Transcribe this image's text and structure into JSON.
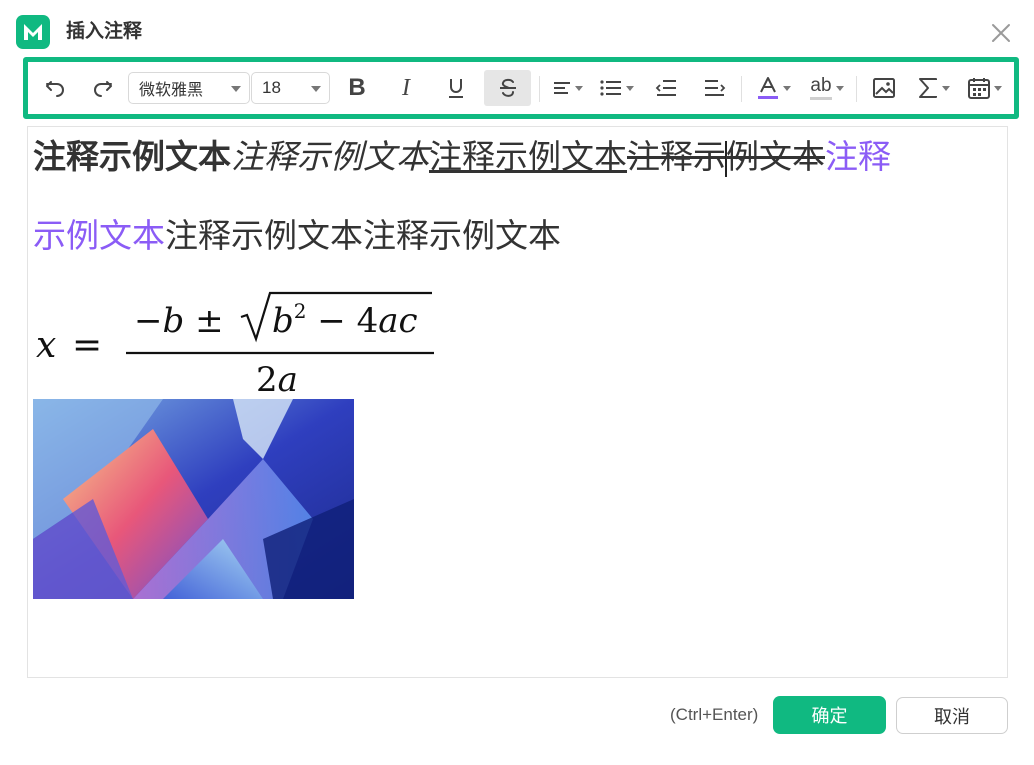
{
  "window": {
    "title": "插入注释",
    "app_icon": "mindmaster-logo-icon",
    "close_icon": "close-icon"
  },
  "colors": {
    "accent": "#10b981",
    "purple_text": "#8b5cf6",
    "text": "#333333"
  },
  "toolbar": {
    "font_family": "微软雅黑",
    "font_size": "18",
    "tools": [
      "undo-icon",
      "redo-icon",
      "bold-icon",
      "italic-icon",
      "underline-icon",
      "strikethrough-icon",
      "align-icon",
      "list-icon",
      "outdent-icon",
      "indent-icon",
      "font-color-icon",
      "highlight-icon",
      "image-icon",
      "formula-icon",
      "date-icon"
    ],
    "strikethrough_active": true,
    "bold_label": "B",
    "italic_label": "I",
    "highlight_label": "ab"
  },
  "editor": {
    "line1": {
      "bold": "注释示例文本",
      "italic": "注释示例文本",
      "underline": "注释示例文本",
      "strike_before_caret": "注释示",
      "strike_after_caret": "例文本",
      "purple": "注释"
    },
    "line2": {
      "purple": "示例文本",
      "normal": "注释示例文本注释示例文本"
    },
    "formula": "x = (−b ± √(b² − 4ac)) / 2a",
    "image": "abstract-gradient-image"
  },
  "footer": {
    "shortcut": "(Ctrl+Enter)",
    "ok_label": "确定",
    "cancel_label": "取消"
  }
}
